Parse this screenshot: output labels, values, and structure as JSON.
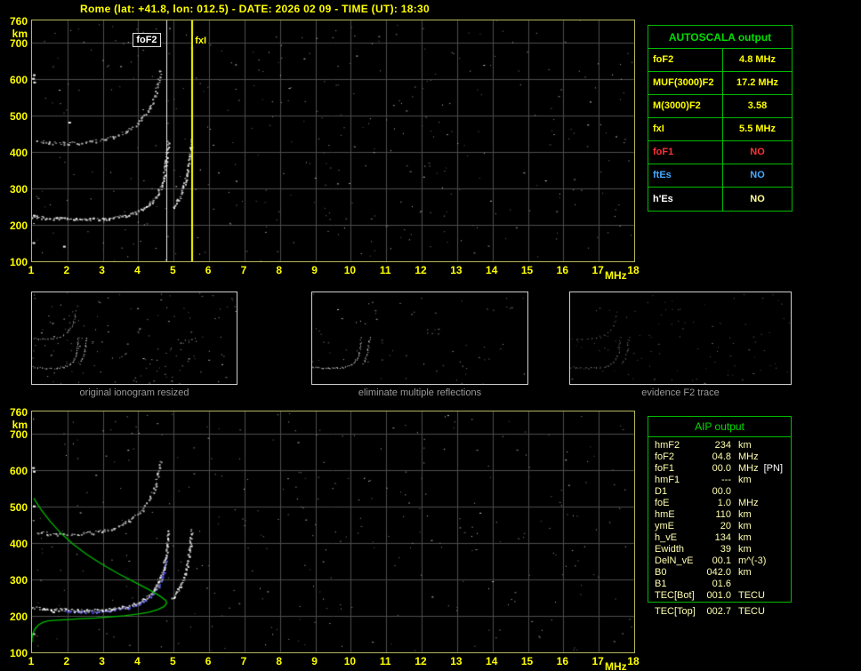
{
  "title": "Rome (lat: +41.8, lon: 012.5) - DATE: 2026 02 09 - TIME (UT): 18:30",
  "colors": {
    "title": "#ffff00",
    "axis_labels": "#ffff00",
    "plot_border": "#b6b65e",
    "grid": "#4c4c4c",
    "table_border_green": "#00bb00",
    "table_header_green": "#00dd00",
    "aip_text": "#ffffb0",
    "caption_gray": "#9a9a9a",
    "foF1_red": "#ff3232",
    "ftEs_blue": "#44aaff",
    "value_yellow": "#ffff00",
    "profile_green": "#00bb00",
    "fitted_trace_blue": "#5050ff",
    "foF2_marker_white": "#ededed",
    "fxI_marker_yellow": "#ffff00"
  },
  "axes": {
    "x_ticks": [
      "1",
      "2",
      "3",
      "4",
      "5",
      "6",
      "7",
      "8",
      "9",
      "10",
      "11",
      "12",
      "13",
      "14",
      "15",
      "16",
      "17",
      "18"
    ],
    "x_unit": "MHz",
    "y_ticks": [
      "760",
      "700",
      "600",
      "500",
      "400",
      "300",
      "200",
      "100"
    ],
    "y_unit": "km"
  },
  "top_plot": {
    "foF2_label": "foF2",
    "fxI_label": "fxI"
  },
  "autoscala_table": {
    "title": "AUTOSCALA output",
    "rows": [
      {
        "param": "foF2",
        "value": "4.8 MHz",
        "param_color": "#ffff00",
        "value_color": "#ffff00"
      },
      {
        "param": "MUF(3000)F2",
        "value": "17.2 MHz",
        "param_color": "#ffff00",
        "value_color": "#ffff00"
      },
      {
        "param": "M(3000)F2",
        "value": "3.58",
        "param_color": "#ffff00",
        "value_color": "#ffff00"
      },
      {
        "param": "fxI",
        "value": "5.5 MHz",
        "param_color": "#ffff00",
        "value_color": "#ffff00"
      },
      {
        "param": "foF1",
        "value": "NO",
        "param_color": "#ff3232",
        "value_color": "#ff3232"
      },
      {
        "param": "ftEs",
        "value": "NO",
        "param_color": "#44aaff",
        "value_color": "#44aaff"
      },
      {
        "param": "h'Es",
        "value": "NO",
        "param_color": "#ffffff",
        "value_color": "#ffff99"
      }
    ]
  },
  "thumbnails": {
    "captions": [
      "original ionogram resized",
      "eliminate multiple reflections",
      "evidence F2 trace"
    ]
  },
  "aip_table": {
    "title": "AIP output",
    "rows": [
      {
        "param": "hmF2",
        "value": "234",
        "unit": "km"
      },
      {
        "param": "foF2",
        "value": "04.8",
        "unit": "MHz"
      },
      {
        "param": "foF1",
        "value": "00.0",
        "unit": "MHz",
        "flag": "[PN]"
      },
      {
        "param": "hmF1",
        "value": "---",
        "unit": "km"
      },
      {
        "param": "D1",
        "value": "00.0",
        "unit": ""
      },
      {
        "param": "foE",
        "value": "1.0",
        "unit": "MHz"
      },
      {
        "param": "hmE",
        "value": "110",
        "unit": "km"
      },
      {
        "param": "ymE",
        "value": "20",
        "unit": "km"
      },
      {
        "param": "h_vE",
        "value": "134",
        "unit": "km"
      },
      {
        "param": "Ewidth",
        "value": "39",
        "unit": "km"
      },
      {
        "param": "DelN_vE",
        "value": "00.1",
        "unit": "m^(-3)"
      },
      {
        "param": "B0",
        "value": "042.0",
        "unit": "km"
      },
      {
        "param": "B1",
        "value": "01.6",
        "unit": ""
      }
    ],
    "tec_rows": [
      {
        "param": "TEC[Bot]",
        "value": "001.0",
        "unit": "TECU"
      },
      {
        "param": "TEC[Top]",
        "value": "002.7",
        "unit": "TECU"
      }
    ]
  },
  "chart_data": {
    "type": "scatter",
    "title": "Ionogram, Rome, 2026-02-09 18:30 UT",
    "xlabel": "MHz",
    "ylabel": "km",
    "xlim": [
      1,
      18
    ],
    "ylim": [
      100,
      760
    ],
    "grid": true,
    "markers": {
      "foF2": 4.8,
      "fxI": 5.5
    },
    "traces": {
      "o_mode": [
        [
          1.0,
          223
        ],
        [
          1.4,
          220
        ],
        [
          1.8,
          218
        ],
        [
          2.2,
          216
        ],
        [
          2.6,
          216
        ],
        [
          3.0,
          217
        ],
        [
          3.3,
          220
        ],
        [
          3.6,
          225
        ],
        [
          3.9,
          234
        ],
        [
          4.15,
          246
        ],
        [
          4.35,
          261
        ],
        [
          4.5,
          280
        ],
        [
          4.62,
          303
        ],
        [
          4.7,
          330
        ],
        [
          4.76,
          362
        ],
        [
          4.8,
          398
        ],
        [
          4.83,
          432
        ]
      ],
      "x_mode": [
        [
          4.95,
          248
        ],
        [
          5.08,
          265
        ],
        [
          5.2,
          287
        ],
        [
          5.3,
          313
        ],
        [
          5.38,
          345
        ],
        [
          5.44,
          382
        ],
        [
          5.48,
          415
        ],
        [
          5.5,
          438
        ]
      ],
      "second_hop": [
        [
          1.1,
          430
        ],
        [
          1.5,
          426
        ],
        [
          1.9,
          424
        ],
        [
          2.3,
          425
        ],
        [
          2.7,
          429
        ],
        [
          3.0,
          434
        ],
        [
          3.3,
          442
        ],
        [
          3.6,
          454
        ],
        [
          3.85,
          470
        ],
        [
          4.1,
          492
        ],
        [
          4.3,
          520
        ],
        [
          4.45,
          552
        ],
        [
          4.55,
          588
        ],
        [
          4.62,
          625
        ]
      ]
    },
    "fitted_trace_blue": [
      [
        1.9,
        213
      ],
      [
        2.4,
        212
      ],
      [
        2.9,
        213
      ],
      [
        3.3,
        217
      ],
      [
        3.7,
        224
      ],
      [
        4.0,
        233
      ],
      [
        4.2,
        245
      ],
      [
        4.4,
        261
      ],
      [
        4.55,
        281
      ],
      [
        4.66,
        306
      ],
      [
        4.74,
        334
      ],
      [
        4.79,
        362
      ]
    ],
    "profile_green_topside": [
      [
        1.05,
        522
      ],
      [
        1.25,
        492
      ],
      [
        1.5,
        460
      ],
      [
        1.8,
        428
      ],
      [
        2.15,
        397
      ],
      [
        2.55,
        368
      ],
      [
        3.0,
        340
      ],
      [
        3.45,
        315
      ],
      [
        3.9,
        292
      ],
      [
        4.3,
        272
      ],
      [
        4.6,
        255
      ],
      [
        4.78,
        242
      ],
      [
        4.8,
        234
      ]
    ],
    "profile_green_bottomside": [
      [
        4.8,
        234
      ],
      [
        4.72,
        225
      ],
      [
        4.55,
        217
      ],
      [
        4.3,
        210
      ],
      [
        4.0,
        205
      ],
      [
        3.6,
        200
      ],
      [
        3.2,
        197
      ],
      [
        2.8,
        194
      ],
      [
        2.4,
        192
      ],
      [
        2.0,
        190
      ],
      [
        1.7,
        188
      ],
      [
        1.45,
        186
      ],
      [
        1.3,
        182
      ],
      [
        1.18,
        175
      ],
      [
        1.08,
        164
      ],
      [
        1.02,
        150
      ],
      [
        1.0,
        138
      ],
      [
        1.0,
        128
      ]
    ],
    "bright_spots_top": [
      [
        1.03,
        600
      ],
      [
        1.06,
        590
      ],
      [
        1.05,
        610
      ],
      [
        1.9,
        140
      ],
      [
        1.05,
        225
      ],
      [
        1.04,
        150
      ],
      [
        2.05,
        480
      ]
    ],
    "bright_spots_bottom": [
      [
        1.03,
        605
      ],
      [
        1.05,
        595
      ],
      [
        1.6,
        210
      ],
      [
        1.05,
        500
      ],
      [
        1.04,
        150
      ]
    ],
    "render": {
      "top": {
        "seed": 42,
        "noise": 380
      },
      "bottom": {
        "seed": 77,
        "noise": 330
      },
      "thumbs": [
        {
          "seed": 7,
          "noise": 150
        },
        {
          "seed": 8,
          "noise": 70
        },
        {
          "seed": 9,
          "noise": 95
        }
      ]
    }
  }
}
